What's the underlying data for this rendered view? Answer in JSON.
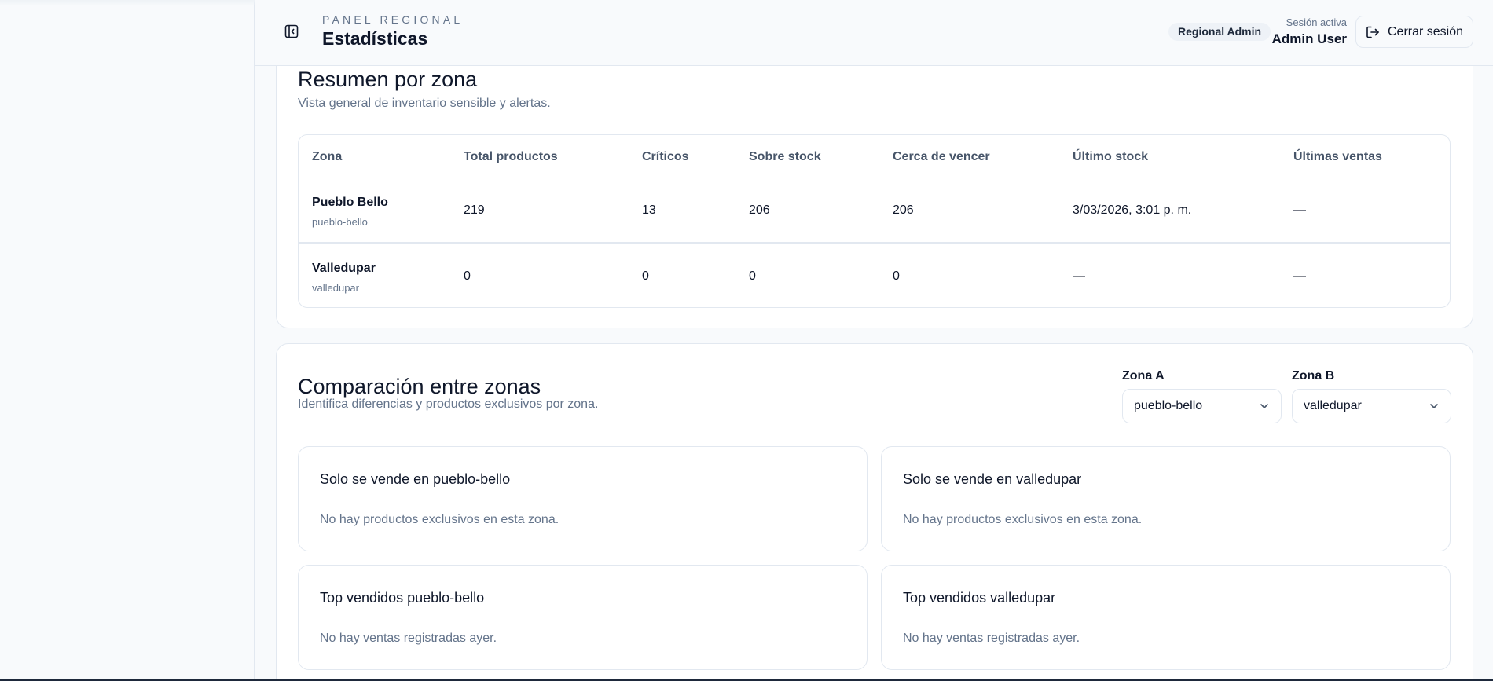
{
  "header": {
    "kicker": "PANEL REGIONAL",
    "title": "Estadísticas",
    "role_badge": "Regional Admin",
    "session_label": "Sesión activa",
    "session_user": "Admin User",
    "logout_label": "Cerrar sesión"
  },
  "summary": {
    "title": "Resumen por zona",
    "subtitle": "Vista general de inventario sensible y alertas.",
    "columns": [
      "Zona",
      "Total productos",
      "Críticos",
      "Sobre stock",
      "Cerca de vencer",
      "Último stock",
      "Últimas ventas"
    ],
    "rows": [
      {
        "zone": "Pueblo Bello",
        "slug": "pueblo-bello",
        "total": "219",
        "criticos": "13",
        "sobre_stock": "206",
        "cerca_vencer": "206",
        "ultimo_stock": "3/03/2026, 3:01 p. m.",
        "ultimas_ventas": "—"
      },
      {
        "zone": "Valledupar",
        "slug": "valledupar",
        "total": "0",
        "criticos": "0",
        "sobre_stock": "0",
        "cerca_vencer": "0",
        "ultimo_stock": "—",
        "ultimas_ventas": "—"
      }
    ]
  },
  "comparison": {
    "title": "Comparación entre zonas",
    "subtitle": "Identifica diferencias y productos exclusivos por zona.",
    "zone_a_label": "Zona A",
    "zone_a_value": "pueblo-bello",
    "zone_b_label": "Zona B",
    "zone_b_value": "valledupar",
    "cards": [
      {
        "title": "Solo se vende en pueblo-bello",
        "empty": "No hay productos exclusivos en esta zona."
      },
      {
        "title": "Solo se vende en valledupar",
        "empty": "No hay productos exclusivos en esta zona."
      },
      {
        "title": "Top vendidos pueblo-bello",
        "empty": "No hay ventas registradas ayer."
      },
      {
        "title": "Top vendidos valledupar",
        "empty": "No hay ventas registradas ayer."
      }
    ]
  },
  "icons": {
    "collapse": "sidebar-collapse-icon",
    "logout": "logout-icon",
    "chevron": "chevron-down-icon"
  },
  "colors": {
    "background": "#f8fafc",
    "card": "#ffffff",
    "border": "#e2e8f0",
    "muted_text": "#64748b",
    "badge_bg": "#eef2f7"
  }
}
